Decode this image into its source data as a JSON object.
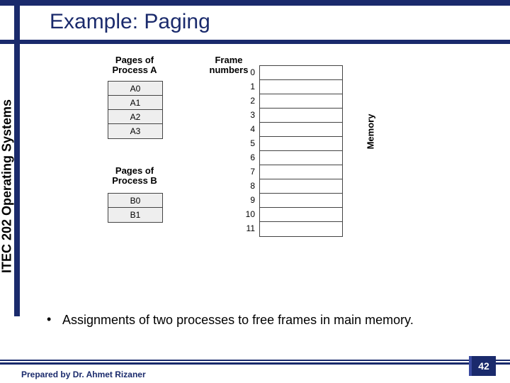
{
  "course": "ITEC 202 Operating Systems",
  "title": "Example: Paging",
  "labels": {
    "pagesA": "Pages of\nProcess A",
    "pagesB": "Pages of\nProcess B",
    "frames": "Frame\nnumbers",
    "memory": "Memory"
  },
  "processA": [
    "A0",
    "A1",
    "A2",
    "A3"
  ],
  "processB": [
    "B0",
    "B1"
  ],
  "frameNumbers": [
    "0",
    "1",
    "2",
    "3",
    "4",
    "5",
    "6",
    "7",
    "8",
    "9",
    "10",
    "11"
  ],
  "bullet": "Assignments of two processes to free frames in main memory.",
  "footer": {
    "prepared": "Prepared by Dr. Ahmet Rizaner",
    "page": "42"
  }
}
